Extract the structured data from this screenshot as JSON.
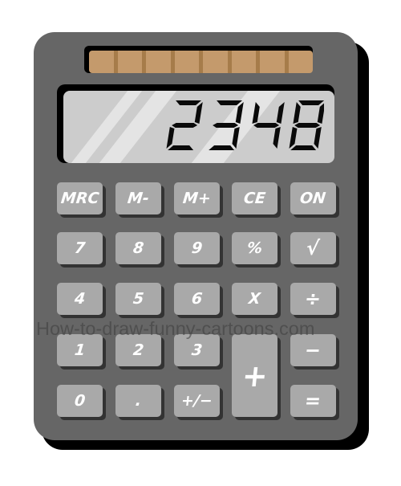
{
  "calculator": {
    "display": {
      "value": "2348"
    },
    "solar_panel": {
      "cells": 8
    },
    "colors": {
      "body": "#666666",
      "key": "#a9a9a9",
      "key_text": "#ffffff",
      "screen": "#cccccc",
      "solar": "#c49a6c"
    },
    "keys": [
      {
        "id": "mrc",
        "label": "MRC"
      },
      {
        "id": "m-minus",
        "label": "M-"
      },
      {
        "id": "m-plus",
        "label": "M+"
      },
      {
        "id": "ce",
        "label": "CE"
      },
      {
        "id": "on",
        "label": "ON"
      },
      {
        "id": "seven",
        "label": "7"
      },
      {
        "id": "eight",
        "label": "8"
      },
      {
        "id": "nine",
        "label": "9"
      },
      {
        "id": "percent",
        "label": "%"
      },
      {
        "id": "sqrt",
        "label": "√"
      },
      {
        "id": "four",
        "label": "4"
      },
      {
        "id": "five",
        "label": "5"
      },
      {
        "id": "six",
        "label": "6"
      },
      {
        "id": "multiply",
        "label": "X"
      },
      {
        "id": "divide",
        "label": "÷"
      },
      {
        "id": "one",
        "label": "1"
      },
      {
        "id": "two",
        "label": "2"
      },
      {
        "id": "three",
        "label": "3"
      },
      {
        "id": "plus",
        "label": "+"
      },
      {
        "id": "minus",
        "label": "−"
      },
      {
        "id": "zero",
        "label": "0"
      },
      {
        "id": "decimal",
        "label": "."
      },
      {
        "id": "plus-minus",
        "label": "+/−"
      },
      {
        "id": "equals",
        "label": "="
      }
    ]
  },
  "watermark": "How-to-draw-funny-cartoons.com"
}
